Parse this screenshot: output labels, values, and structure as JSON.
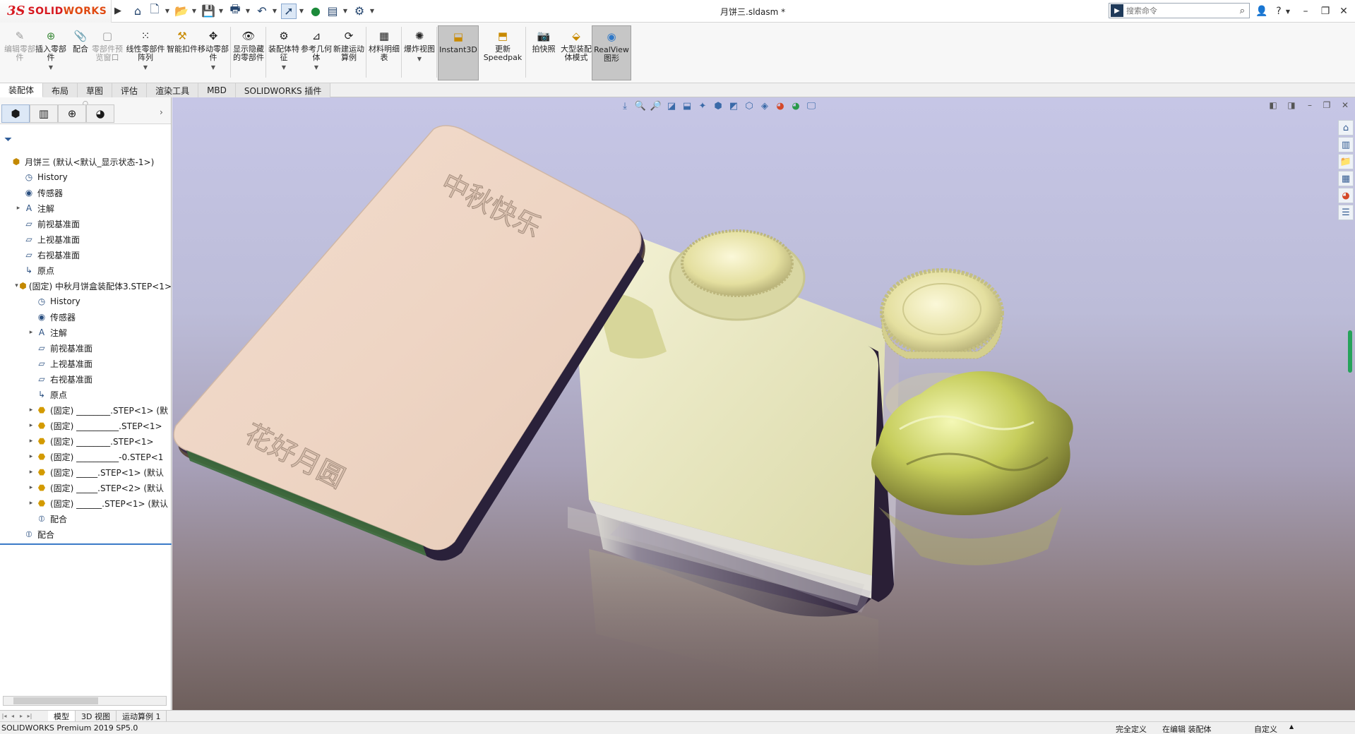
{
  "app": {
    "logo_ds": "3S",
    "logo_text_a": "SOLID",
    "logo_text_b": "WORKS",
    "doc_title": "月饼三.sldasm *",
    "search_placeholder": "搜索命令"
  },
  "ribbon": {
    "buttons": [
      {
        "label": "编辑零部件",
        "icon": "edit-part-icon",
        "disabled": true
      },
      {
        "label": "插入零部件",
        "icon": "insert-component-icon"
      },
      {
        "label": "配合",
        "icon": "mate-icon"
      },
      {
        "label": "零部件预览窗口",
        "icon": "component-preview-icon",
        "disabled": true
      },
      {
        "label": "线性零部件阵列",
        "icon": "linear-pattern-icon"
      },
      {
        "label": "智能扣件",
        "icon": "smart-fastener-icon"
      },
      {
        "label": "移动零部件",
        "icon": "move-component-icon"
      },
      {
        "label": "显示隐藏的零部件",
        "icon": "show-hidden-icon"
      },
      {
        "label": "装配体特征",
        "icon": "assembly-feature-icon"
      },
      {
        "label": "参考几何体",
        "icon": "reference-geometry-icon"
      },
      {
        "label": "新建运动算例",
        "icon": "new-motion-study-icon"
      },
      {
        "label": "材料明细表",
        "icon": "bom-icon"
      },
      {
        "label": "爆炸视图",
        "icon": "exploded-view-icon"
      },
      {
        "label": "Instant3D",
        "icon": "instant3d-icon",
        "active": true
      },
      {
        "label": "更新Speedpak",
        "icon": "speedpak-icon"
      },
      {
        "label": "拍快照",
        "icon": "snapshot-icon"
      },
      {
        "label": "大型装配体模式",
        "icon": "large-assembly-icon"
      },
      {
        "label": "RealView图形",
        "icon": "realview-icon",
        "active": true
      }
    ]
  },
  "command_tabs": [
    "装配体",
    "布局",
    "草图",
    "评估",
    "渲染工具",
    "MBD",
    "SOLIDWORKS 插件"
  ],
  "tree": [
    {
      "label": "月饼三 (默认<默认_显示状态-1>)",
      "icon": "asm",
      "indent": 0,
      "exp": ""
    },
    {
      "label": "History",
      "icon": "history",
      "indent": 1,
      "exp": ""
    },
    {
      "label": "传感器",
      "icon": "sensor",
      "indent": 1,
      "exp": ""
    },
    {
      "label": "注解",
      "icon": "annotation",
      "indent": 1,
      "exp": "▸"
    },
    {
      "label": "前视基准面",
      "icon": "plane",
      "indent": 1,
      "exp": ""
    },
    {
      "label": "上视基准面",
      "icon": "plane",
      "indent": 1,
      "exp": ""
    },
    {
      "label": "右视基准面",
      "icon": "plane",
      "indent": 1,
      "exp": ""
    },
    {
      "label": "原点",
      "icon": "origin",
      "indent": 1,
      "exp": ""
    },
    {
      "label": "(固定) 中秋月饼盒装配体3.STEP<1>",
      "icon": "asm",
      "indent": 1,
      "exp": "▾"
    },
    {
      "label": "History",
      "icon": "history",
      "indent": 2,
      "exp": ""
    },
    {
      "label": "传感器",
      "icon": "sensor",
      "indent": 2,
      "exp": ""
    },
    {
      "label": "注解",
      "icon": "annotation",
      "indent": 2,
      "exp": "▸"
    },
    {
      "label": "前视基准面",
      "icon": "plane",
      "indent": 2,
      "exp": ""
    },
    {
      "label": "上视基准面",
      "icon": "plane",
      "indent": 2,
      "exp": ""
    },
    {
      "label": "右视基准面",
      "icon": "plane",
      "indent": 2,
      "exp": ""
    },
    {
      "label": "原点",
      "icon": "origin",
      "indent": 2,
      "exp": ""
    },
    {
      "label": "(固定) ________.STEP<1> (默",
      "icon": "part",
      "indent": 2,
      "exp": "▸"
    },
    {
      "label": "(固定) __________.STEP<1>",
      "icon": "part",
      "indent": 2,
      "exp": "▸"
    },
    {
      "label": "(固定) ________.STEP<1>",
      "icon": "part",
      "indent": 2,
      "exp": "▸"
    },
    {
      "label": "(固定) __________-0.STEP<1",
      "icon": "part",
      "indent": 2,
      "exp": "▸"
    },
    {
      "label": "(固定) _____.STEP<1> (默认",
      "icon": "part",
      "indent": 2,
      "exp": "▸"
    },
    {
      "label": "(固定) _____.STEP<2> (默认",
      "icon": "part",
      "indent": 2,
      "exp": "▸"
    },
    {
      "label": "(固定) ______.STEP<1> (默认",
      "icon": "part",
      "indent": 2,
      "exp": "▸"
    },
    {
      "label": "配合",
      "icon": "mate",
      "indent": 2,
      "exp": ""
    },
    {
      "label": "配合",
      "icon": "mate",
      "indent": 1,
      "exp": ""
    }
  ],
  "bottom_tabs": [
    "模型",
    "3D 视图",
    "运动算例 1"
  ],
  "status": {
    "app_version": "SOLIDWORKS Premium 2019 SP5.0",
    "defined": "完全定义",
    "editing": "在编辑 装配体",
    "custom": "自定义"
  },
  "lid_text_top": "中秋快乐",
  "lid_text_bottom": "花好月圆",
  "colors": {
    "lid": "#f0d8c8",
    "box_side": "#3a2c46",
    "tray": "#f3f2cf",
    "mooncake": "#e8e4a8",
    "wrapped": "#c8d060"
  }
}
